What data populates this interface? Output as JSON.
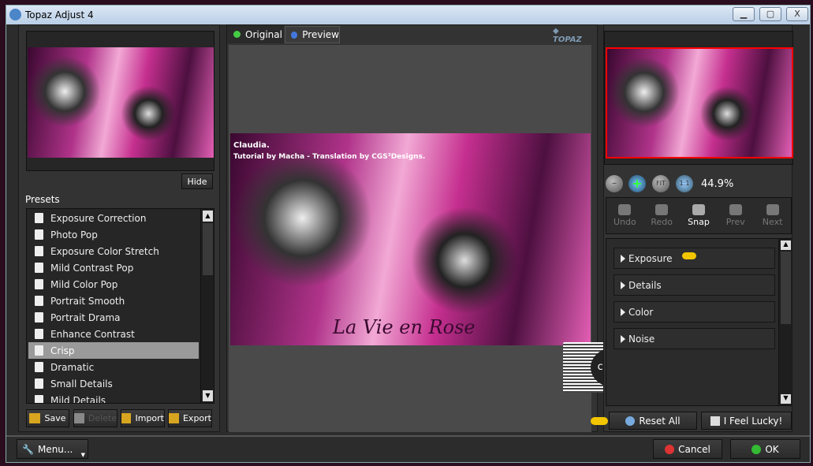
{
  "window": {
    "title": "Topaz Adjust 4",
    "minimize": "▁",
    "maximize": "▢",
    "close": "X"
  },
  "logo": "TOPAZ LABS",
  "left": {
    "hide_label": "Hide",
    "presets_label": "Presets",
    "presets": [
      "Exposure Correction",
      "Photo Pop",
      "Exposure Color Stretch",
      "Mild Contrast Pop",
      "Mild Color Pop",
      "Portrait Smooth",
      "Portrait Drama",
      "Enhance Contrast",
      "Crisp",
      "Dramatic",
      "Small Details",
      "Mild Details"
    ],
    "selected": "Crisp",
    "buttons": {
      "save": "Save",
      "delete": "Delete",
      "import": "Import",
      "export": "Export"
    }
  },
  "tabs": {
    "original": "Original",
    "preview": "Preview"
  },
  "image": {
    "caption_line1": "Claudia.",
    "caption_line2": "Tutorial by Macha - Translation by CGS³Designs.",
    "title": "La Vie en Rose"
  },
  "watermark": "claudia",
  "right": {
    "zoom_level": "44.9%",
    "zoom_buttons": {
      "out": "−",
      "in": "+",
      "fit": "FIT",
      "one": "1:1"
    },
    "history": {
      "undo": "Undo",
      "redo": "Redo",
      "snap": "Snap",
      "prev": "Prev",
      "next": "Next"
    },
    "sections": [
      "Exposure",
      "Details",
      "Color",
      "Noise"
    ],
    "reset_all": "Reset All",
    "lucky": "I Feel Lucky!"
  },
  "bottom": {
    "menu": "Menu...",
    "cancel": "Cancel",
    "ok": "OK"
  },
  "colors": {
    "nav_border": "#ff0000",
    "selected_preset": "#9a9a9a",
    "accent_pointer": "#f2c500"
  }
}
